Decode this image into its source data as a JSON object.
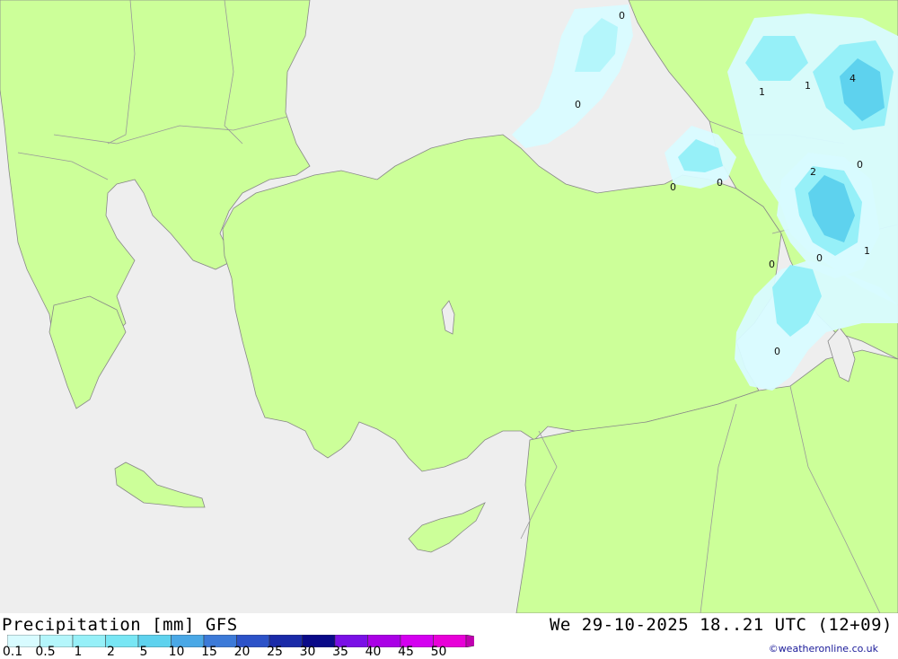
{
  "title": "Precipitation [mm] GFS",
  "valid_time": "We 29-10-2025 18..21 UTC (12+09)",
  "credit": "©weatheronline.co.uk",
  "colors": {
    "sea": "#eeeeee",
    "land": "#ccff99",
    "border": "#999999",
    "coast": "#888888"
  },
  "legend": {
    "labels": [
      "0.1",
      "0.5",
      "1",
      "2",
      "5",
      "10",
      "15",
      "20",
      "25",
      "30",
      "35",
      "40",
      "45",
      "50"
    ],
    "colors": [
      "#d8fbff",
      "#b4f6fb",
      "#96f0f8",
      "#78e6f4",
      "#5ed2ee",
      "#4aa8e6",
      "#3c7ad8",
      "#2c52c8",
      "#1a2aa8",
      "#0a0a88",
      "#7a10e6",
      "#aa00e6",
      "#d400f0",
      "#e800d8",
      "#c000b0"
    ]
  },
  "map_labels": [
    "0",
    "0",
    "0",
    "0",
    "1",
    "1",
    "4",
    "2",
    "0",
    "0",
    "1",
    "0",
    "0"
  ]
}
